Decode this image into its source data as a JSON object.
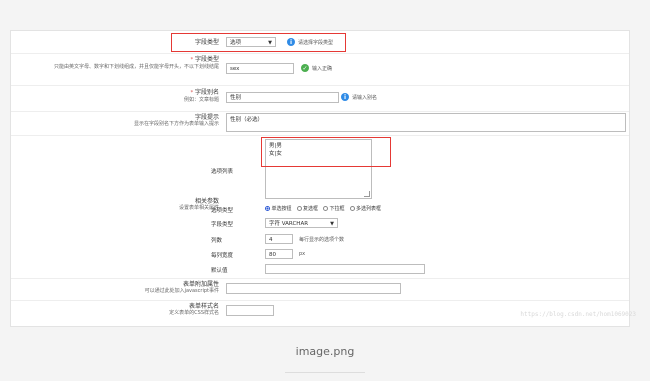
{
  "field_type": {
    "label": "字段类型",
    "value": "选项",
    "hint": "请选择字段类型"
  },
  "field_name": {
    "label": "字段类型",
    "desc": "只能由英文字母、数字和下划线组成，并且仅能字母开头，不以下划线结尾",
    "value": "sex",
    "hint": "输入正确"
  },
  "field_alias": {
    "label": "字段别名",
    "desc": "例如：文章标题",
    "value": "性别",
    "hint": "请输入别名"
  },
  "field_tip": {
    "label": "字段提示",
    "desc": "显示在字段别名下方作为表单输入提示",
    "value": "性别（必选）"
  },
  "options": {
    "label": "选项列表",
    "lines": [
      "男|男",
      "女|女"
    ]
  },
  "related": {
    "label": "相关参数",
    "desc": "设置表单相关属性"
  },
  "option_type": {
    "label": "选项类型",
    "choices": [
      "单选按钮",
      "复选框",
      "下拉框",
      "多选列表框"
    ]
  },
  "field_kind": {
    "label": "字段类型",
    "value": "字符 VARCHAR"
  },
  "columns": {
    "label": "列数",
    "value": "4",
    "hint": "每行显示的选项个数"
  },
  "col_width": {
    "label": "每列宽度",
    "value": "80",
    "unit": "px"
  },
  "default_value": {
    "label": "默认值",
    "value": ""
  },
  "form_attr": {
    "label": "表单附加属性",
    "desc": "可以通过此处加入javascript事件",
    "value": ""
  },
  "form_style": {
    "label": "表单样式名",
    "desc": "定义表单的CSS样式名",
    "value": ""
  },
  "watermark": "https://blog.csdn.net/hom1069023",
  "caption": "image.png",
  "colors": {
    "highlight": "#e53935",
    "info": "#2f8be6",
    "ok": "#4caf50"
  }
}
